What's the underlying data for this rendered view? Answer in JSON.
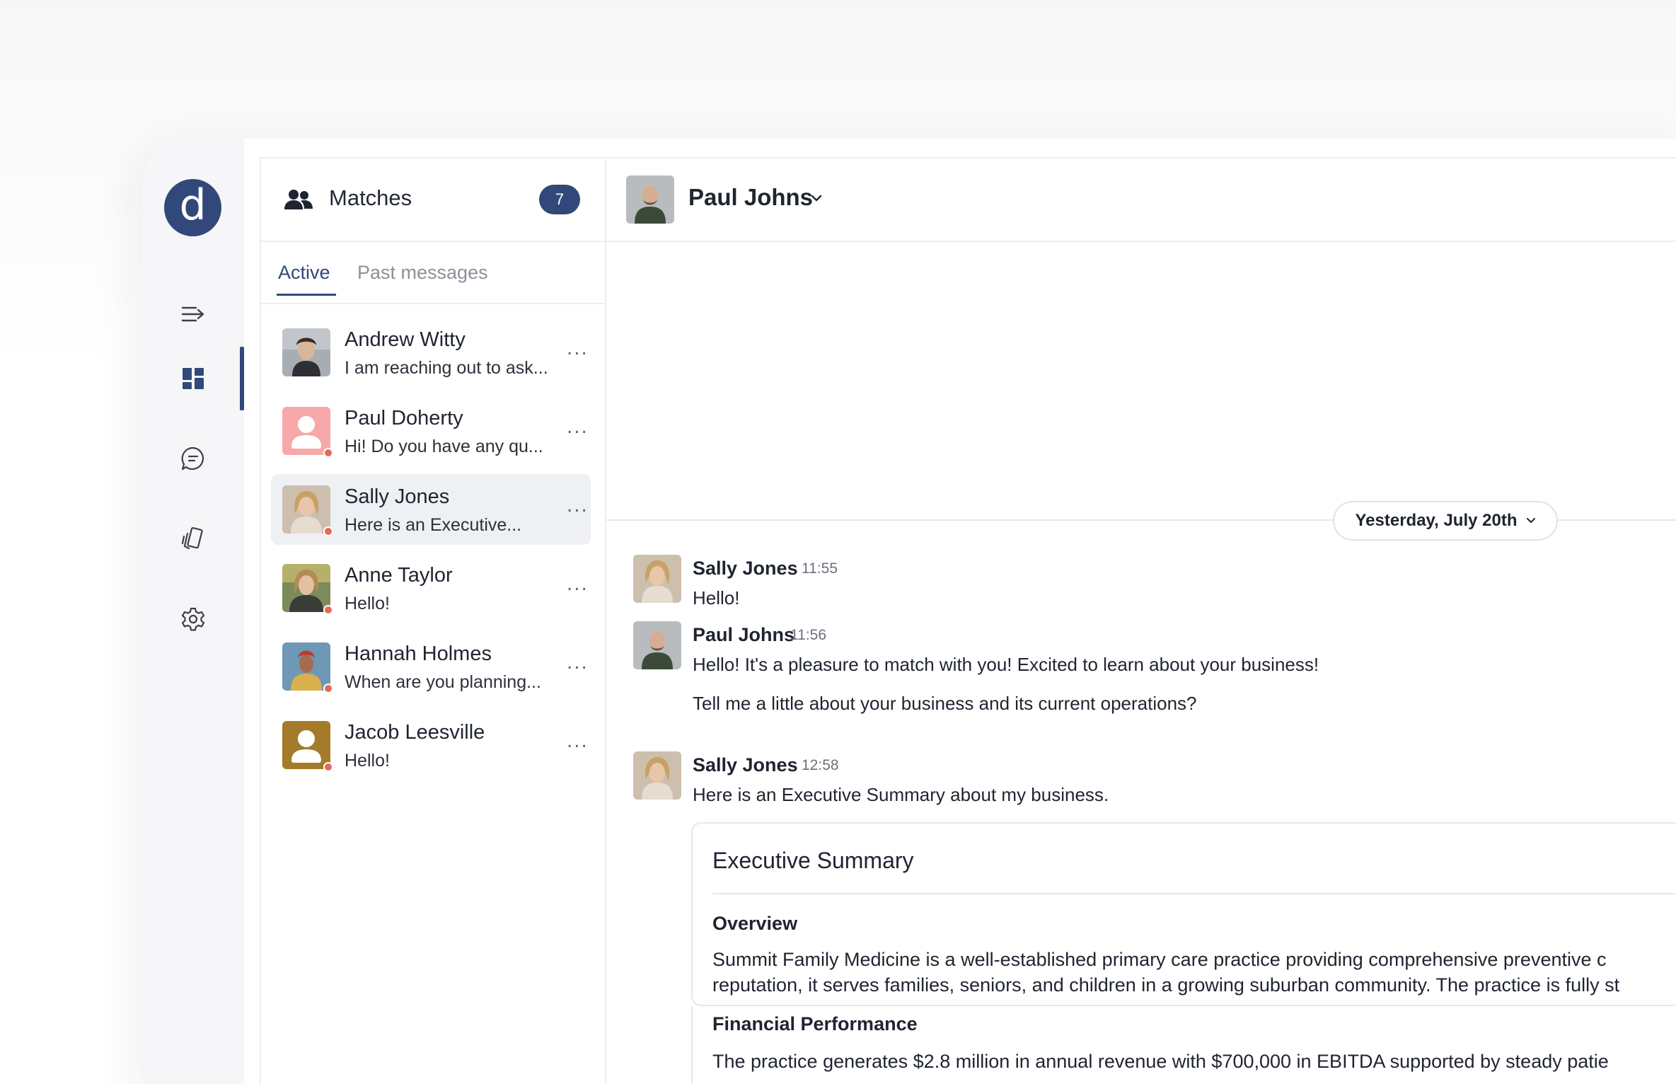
{
  "app": {
    "logo_letter": "d"
  },
  "rail": {
    "items": [
      {
        "icon": "collapse-menu-icon"
      },
      {
        "icon": "dashboard-icon",
        "active": true
      },
      {
        "icon": "chat-icon"
      },
      {
        "icon": "documents-icon"
      },
      {
        "icon": "settings-gear-icon"
      }
    ]
  },
  "matches": {
    "title": "Matches",
    "count": "7",
    "tabs": {
      "active": "Active",
      "past": "Past messages"
    },
    "conversations": [
      {
        "name": "Andrew Witty",
        "preview": "I am reaching out to ask...",
        "online": false,
        "avatar": "photo"
      },
      {
        "name": "Paul Doherty",
        "preview": "Hi! Do you have any qu...",
        "online": true,
        "avatar": "placeholder-pink"
      },
      {
        "name": "Sally Jones",
        "preview": "Here is an Executive...",
        "online": true,
        "avatar": "photo",
        "selected": true
      },
      {
        "name": "Anne Taylor",
        "preview": "Hello!",
        "online": true,
        "avatar": "photo"
      },
      {
        "name": "Hannah Holmes",
        "preview": "When are you planning...",
        "online": true,
        "avatar": "photo"
      },
      {
        "name": "Jacob Leesville",
        "preview": "Hello!",
        "online": true,
        "avatar": "placeholder-gold"
      }
    ],
    "more_label": "..."
  },
  "chat": {
    "contact_name": "Paul Johns",
    "date_divider": "Yesterday, July 20th",
    "messages": [
      {
        "author": "Sally Jones",
        "time": "11:55",
        "lines": [
          "Hello!"
        ]
      },
      {
        "author": "Paul Johns",
        "time": "11:56",
        "lines": [
          "Hello! It's a pleasure to match with you! Excited to learn about your business!",
          "Tell me a little about your business and its current operations?"
        ]
      },
      {
        "author": "Sally Jones",
        "time": "12:58",
        "lines": [
          "Here is an Executive Summary about my business."
        ]
      }
    ],
    "document": {
      "title": "Executive Summary",
      "sections": [
        {
          "heading": "Overview",
          "lines": [
            "Summit Family Medicine is a well-established primary care practice providing comprehensive preventive c",
            "reputation, it serves families, seniors, and children in a growing suburban community. The practice is fully st"
          ]
        },
        {
          "heading": "Financial Performance",
          "lines": [
            "The practice generates $2.8 million in annual revenue with $700,000 in EBITDA supported by steady patie"
          ]
        }
      ]
    }
  },
  "colors": {
    "brand": "#33487a",
    "status_dot": "#e46a55",
    "selected_bg": "#eef0f4",
    "placeholder_pink": "#f7a8a8",
    "placeholder_gold": "#a47b2a"
  }
}
